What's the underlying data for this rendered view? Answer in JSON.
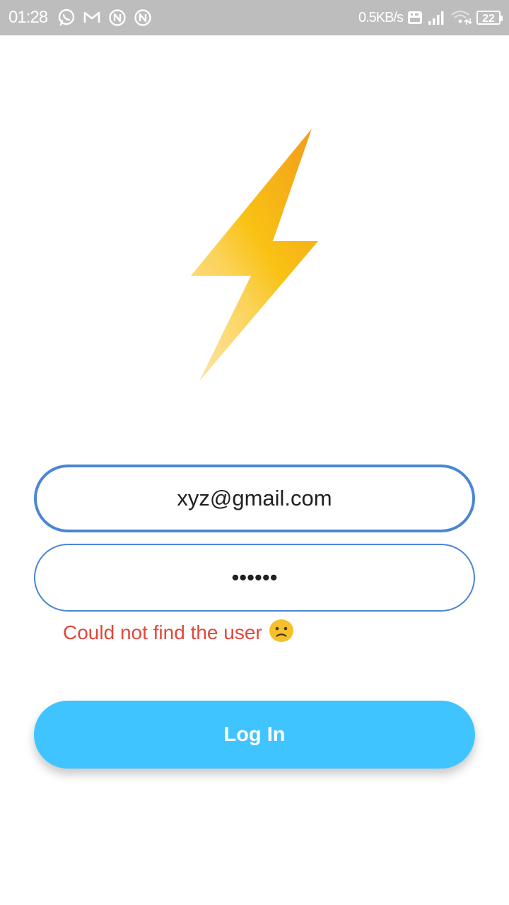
{
  "status_bar": {
    "time": "01:28",
    "net_speed": "0.5KB/s",
    "battery_level": "22",
    "icons": [
      "whatsapp-icon",
      "gmail-icon",
      "app-notification-icon",
      "app-notification-icon",
      "volte-icon",
      "signal-icon",
      "wifi-icon",
      "battery-icon"
    ]
  },
  "logo": {
    "icon": "lightning-bolt-icon",
    "colors": {
      "light": "#fbd976",
      "mid": "#f9c214",
      "dark": "#f29f1b"
    }
  },
  "form": {
    "email_value": "xyz@gmail.com",
    "email_placeholder": "",
    "password_value": "••••••",
    "password_placeholder": ""
  },
  "error": {
    "message": "Could not find the user",
    "icon": "sad-face-emoji-icon"
  },
  "login_button": {
    "label": "Log In"
  },
  "colors": {
    "status_bar": "#bdbdbd",
    "field_border": "#4a86d6",
    "error": "#e2473a",
    "button": "#40c4ff"
  }
}
